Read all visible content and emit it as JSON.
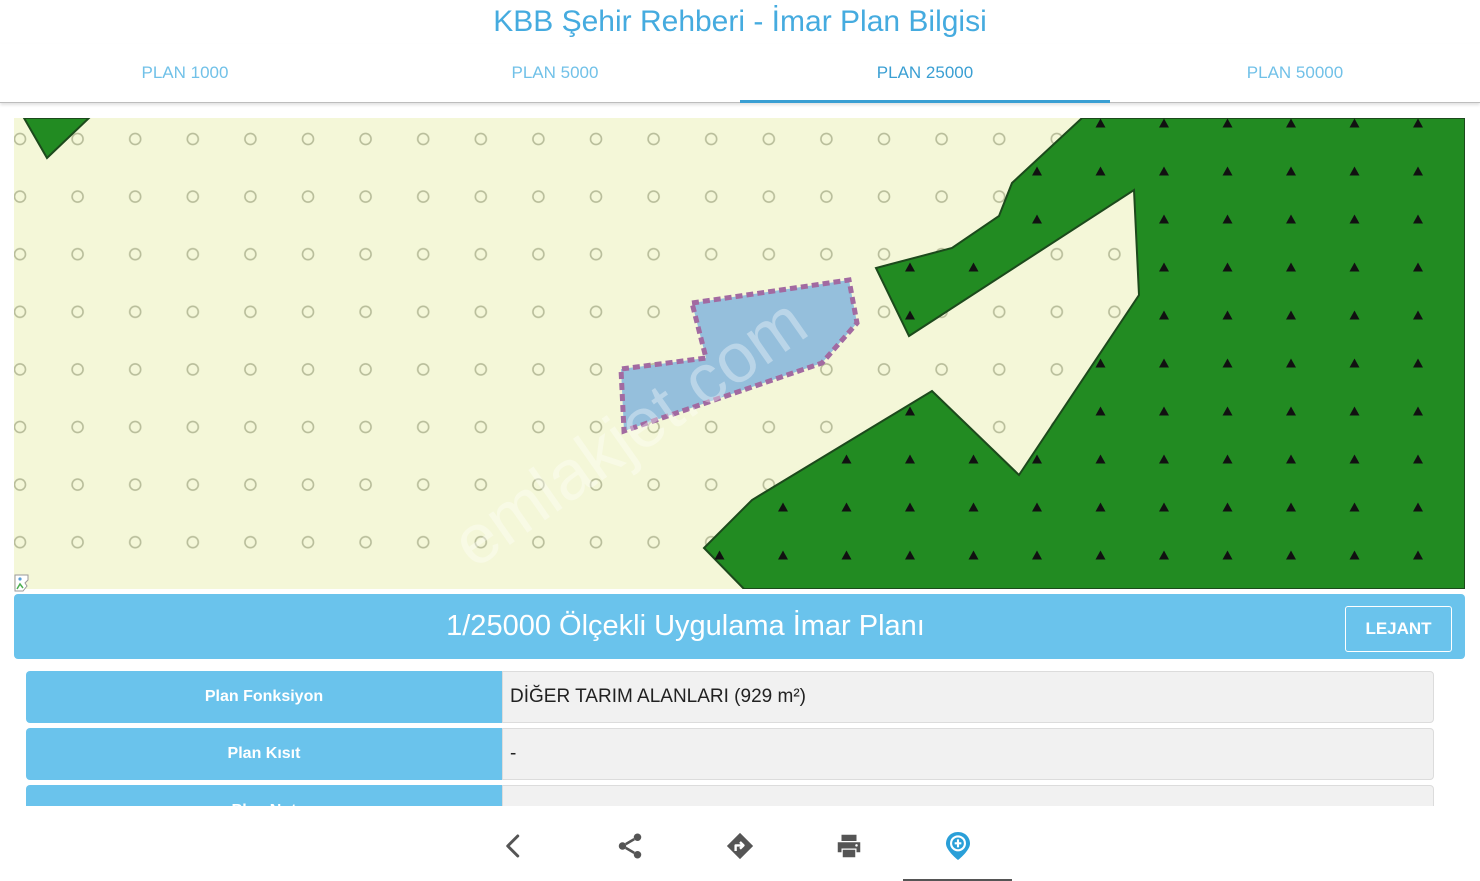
{
  "header": {
    "title": "KBB Şehir Rehberi - İmar Plan Bilgisi"
  },
  "tabs": [
    {
      "label": "PLAN 1000"
    },
    {
      "label": "PLAN 5000"
    },
    {
      "label": "PLAN 25000",
      "active": true
    },
    {
      "label": "PLAN 50000"
    }
  ],
  "map": {
    "watermark": "emlakjet.com",
    "colors": {
      "background": "#f4f7d8",
      "forest": "#228b22",
      "parcel_fill": "#95bfdc",
      "parcel_border": "#a26aa1"
    }
  },
  "plan": {
    "title": "1/25000 Ölçekli Uygulama İmar Planı",
    "lejant_label": "LEJANT",
    "rows": [
      {
        "label": "Plan Fonksiyon",
        "value": "DİĞER TARIM ALANLARI (929 m²)"
      },
      {
        "label": "Plan Kısıt",
        "value": "-"
      },
      {
        "label": "Plan Not",
        "value": ""
      }
    ]
  },
  "bottom_nav": {
    "icons": [
      "back-arrow-icon",
      "share-icon",
      "directions-icon",
      "print-icon",
      "location-info-icon"
    ],
    "accent": "#2a9fd8"
  }
}
